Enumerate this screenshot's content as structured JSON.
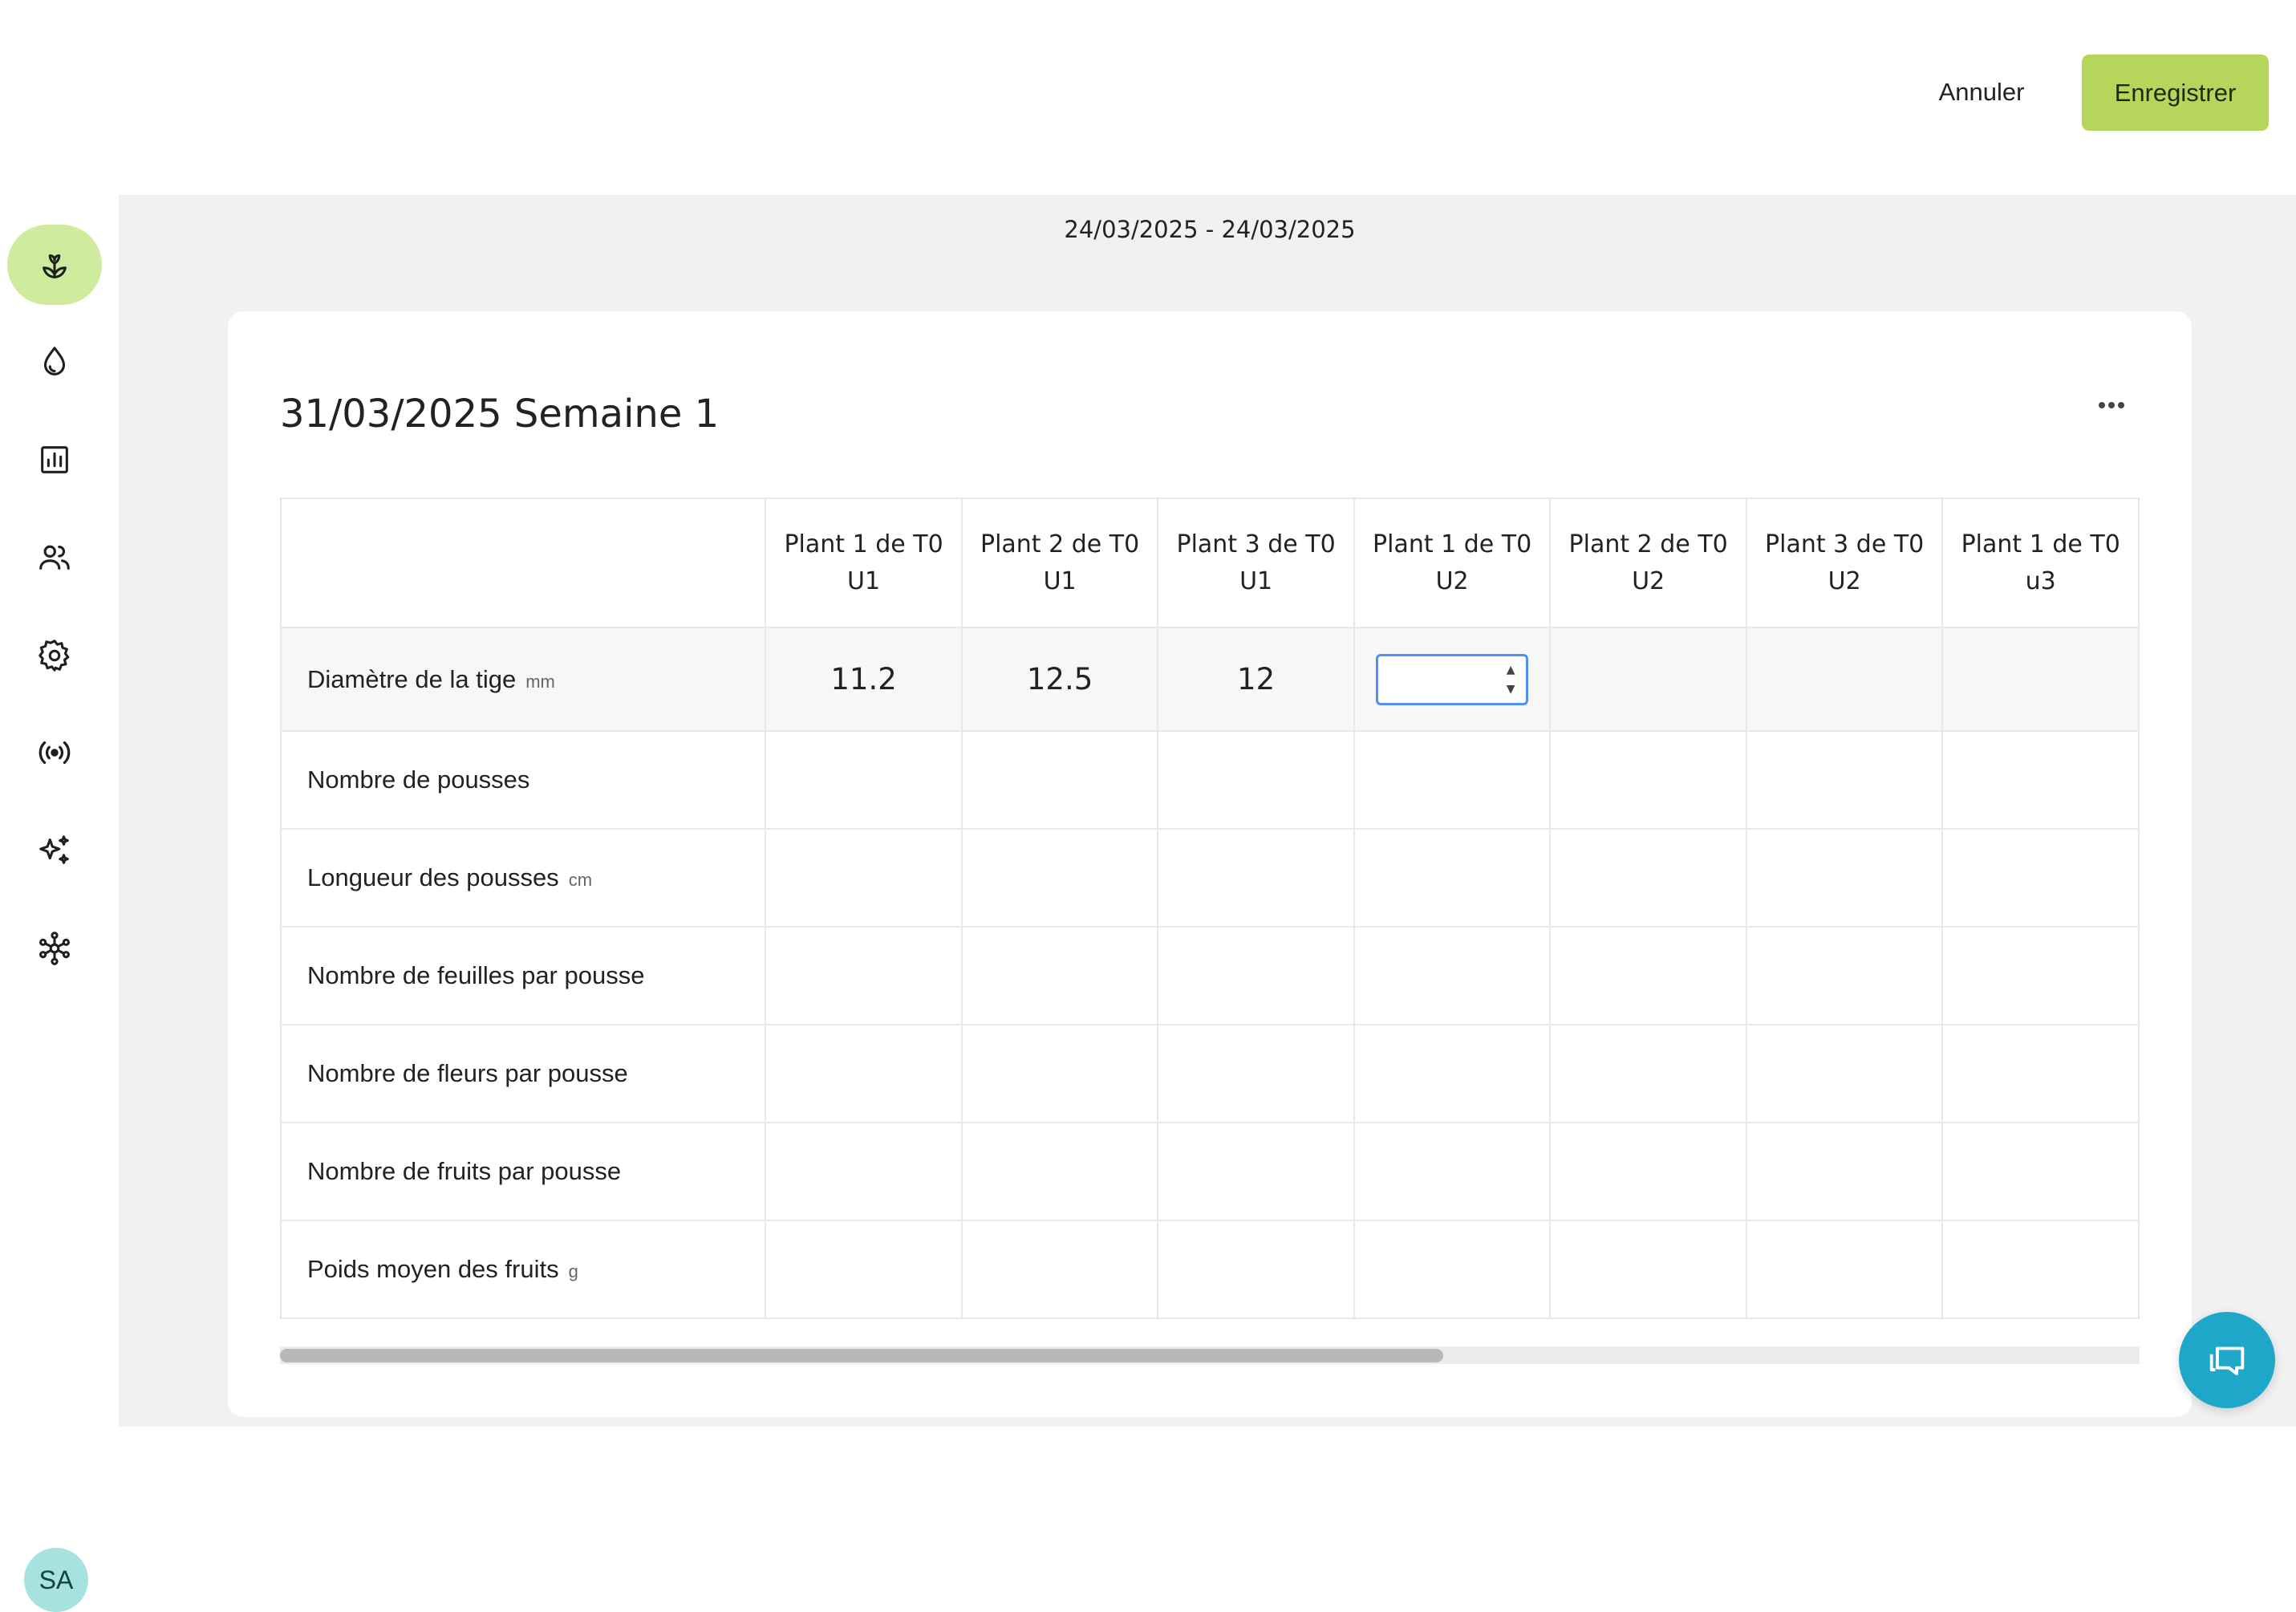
{
  "topbar": {
    "cancel_label": "Annuler",
    "save_label": "Enregistrer"
  },
  "sidebar": {
    "items": [
      {
        "icon": "plant-icon",
        "active": true
      },
      {
        "icon": "water-drop-icon",
        "active": false
      },
      {
        "icon": "bar-chart-icon",
        "active": false
      },
      {
        "icon": "users-icon",
        "active": false
      },
      {
        "icon": "gear-icon",
        "active": false
      },
      {
        "icon": "signal-icon",
        "active": false
      },
      {
        "icon": "sparkles-icon",
        "active": false
      },
      {
        "icon": "network-icon",
        "active": false
      }
    ],
    "avatar_initials": "SA"
  },
  "main": {
    "date_range": "24/03/2025 - 24/03/2025"
  },
  "card": {
    "title": "31/03/2025 Semaine 1",
    "columns": [
      {
        "line1": "Plant 1 de T0",
        "line2": "U1"
      },
      {
        "line1": "Plant 2 de T0",
        "line2": "U1"
      },
      {
        "line1": "Plant 3 de T0",
        "line2": "U1"
      },
      {
        "line1": "Plant 1 de T0",
        "line2": "U2"
      },
      {
        "line1": "Plant 2 de T0",
        "line2": "U2"
      },
      {
        "line1": "Plant 3 de T0",
        "line2": "U2"
      },
      {
        "line1": "Plant 1 de T0",
        "line2": "u3"
      }
    ],
    "rows": [
      {
        "label": "Diamètre de la tige",
        "unit": "mm",
        "values": [
          "11.2",
          "12.5",
          "12",
          "",
          "",
          "",
          ""
        ]
      },
      {
        "label": "Nombre de pousses",
        "unit": "",
        "values": [
          "",
          "",
          "",
          "",
          "",
          "",
          ""
        ]
      },
      {
        "label": "Longueur des pousses",
        "unit": "cm",
        "values": [
          "",
          "",
          "",
          "",
          "",
          "",
          ""
        ]
      },
      {
        "label": "Nombre de feuilles par pousse",
        "unit": "",
        "values": [
          "",
          "",
          "",
          "",
          "",
          "",
          ""
        ]
      },
      {
        "label": "Nombre de fleurs par pousse",
        "unit": "",
        "values": [
          "",
          "",
          "",
          "",
          "",
          "",
          ""
        ]
      },
      {
        "label": "Nombre de fruits par pousse",
        "unit": "",
        "values": [
          "",
          "",
          "",
          "",
          "",
          "",
          ""
        ]
      },
      {
        "label": "Poids moyen des fruits",
        "unit": "g",
        "values": [
          "",
          "",
          "",
          "",
          "",
          "",
          ""
        ]
      }
    ],
    "active_input_value": ""
  },
  "colors": {
    "accent": "#b5d65b",
    "active_nav": "#cfeb9d",
    "chat_fab": "#1ea7c9",
    "focus": "#4f8ff7"
  }
}
